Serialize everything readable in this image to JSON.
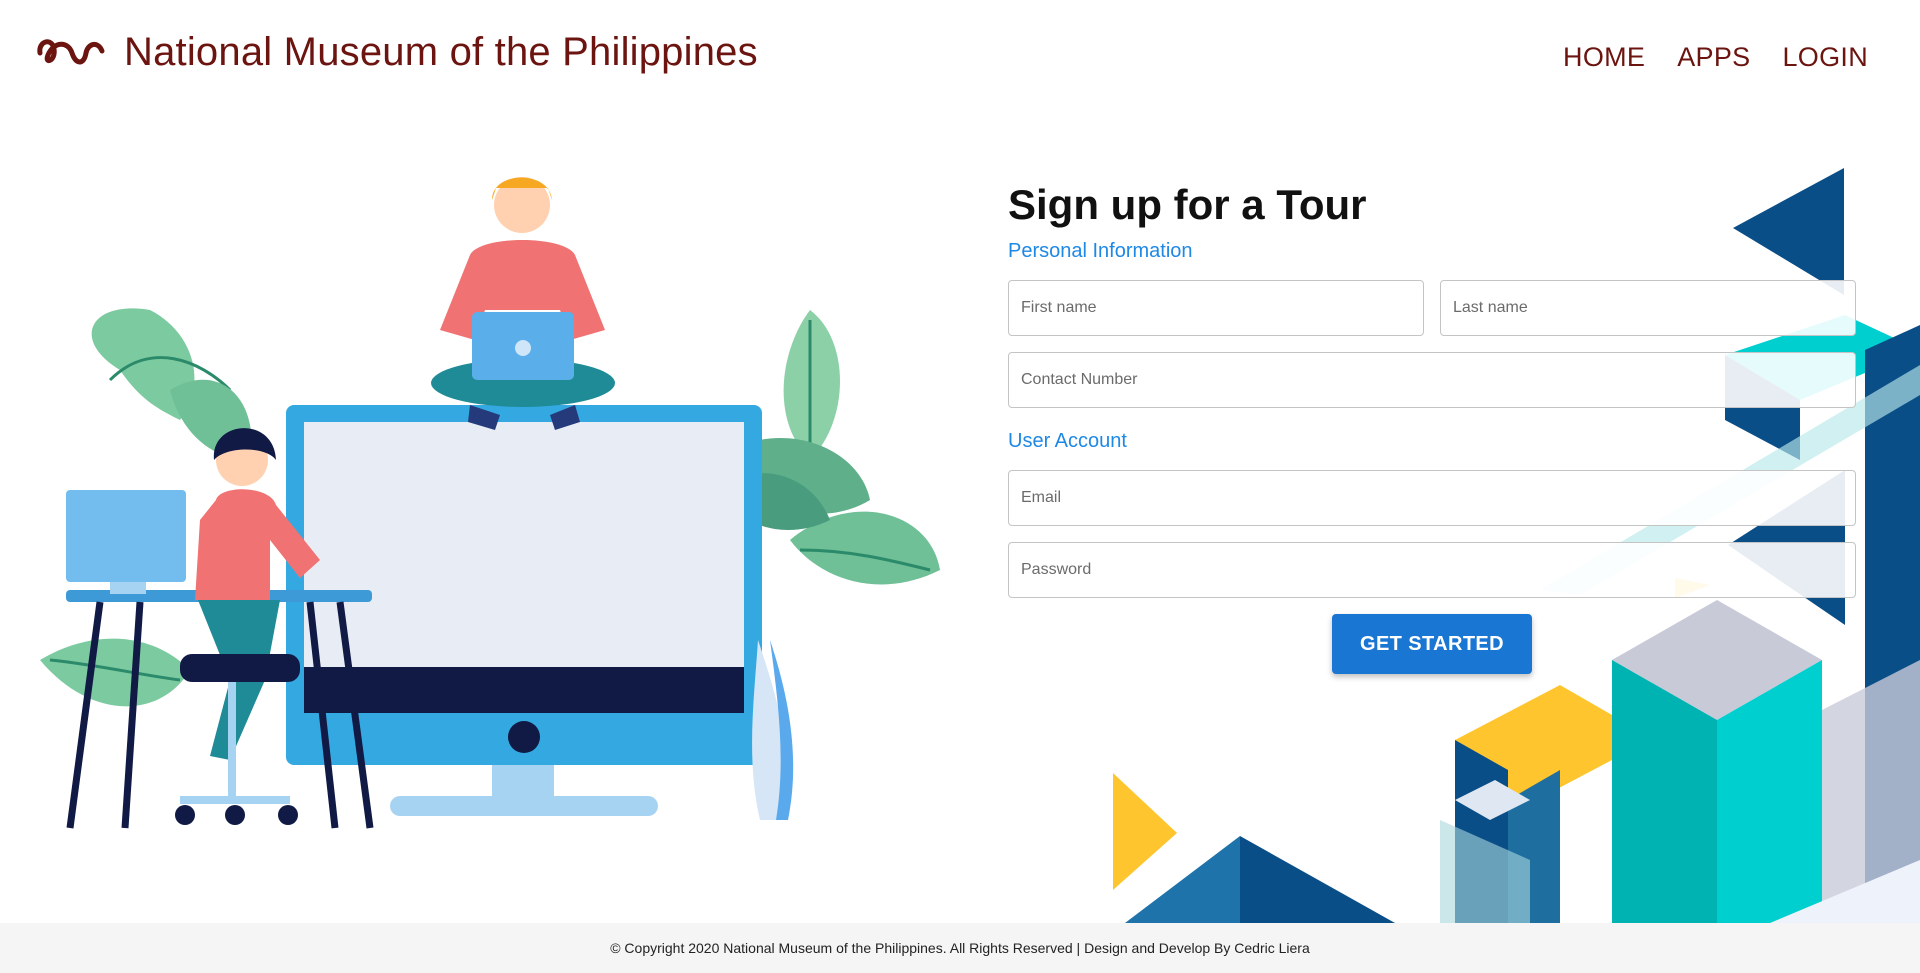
{
  "header": {
    "title": "National Museum of the Philippines",
    "logo_icon": "museum-script-logo",
    "nav": [
      {
        "label": "HOME"
      },
      {
        "label": "APPS"
      },
      {
        "label": "LOGIN"
      }
    ]
  },
  "form": {
    "title": "Sign up for a Tour",
    "personal_section": "Personal Information",
    "first_name_placeholder": "First name",
    "last_name_placeholder": "Last name",
    "contact_placeholder": "Contact Number",
    "account_section": "User Account",
    "email_placeholder": "Email",
    "password_placeholder": "Password",
    "submit_label": "GET STARTED"
  },
  "footer": {
    "text": "© Copyright 2020 National Museum of the Philippines. All Rights Reserved | Design and Develop By Cedric Liera"
  },
  "colors": {
    "brand": "#6b1410",
    "accent": "#1e88e5",
    "button": "#1976d2",
    "navy": "#0a4e88",
    "teal": "#00cfcf",
    "yellow": "#fec52e"
  }
}
